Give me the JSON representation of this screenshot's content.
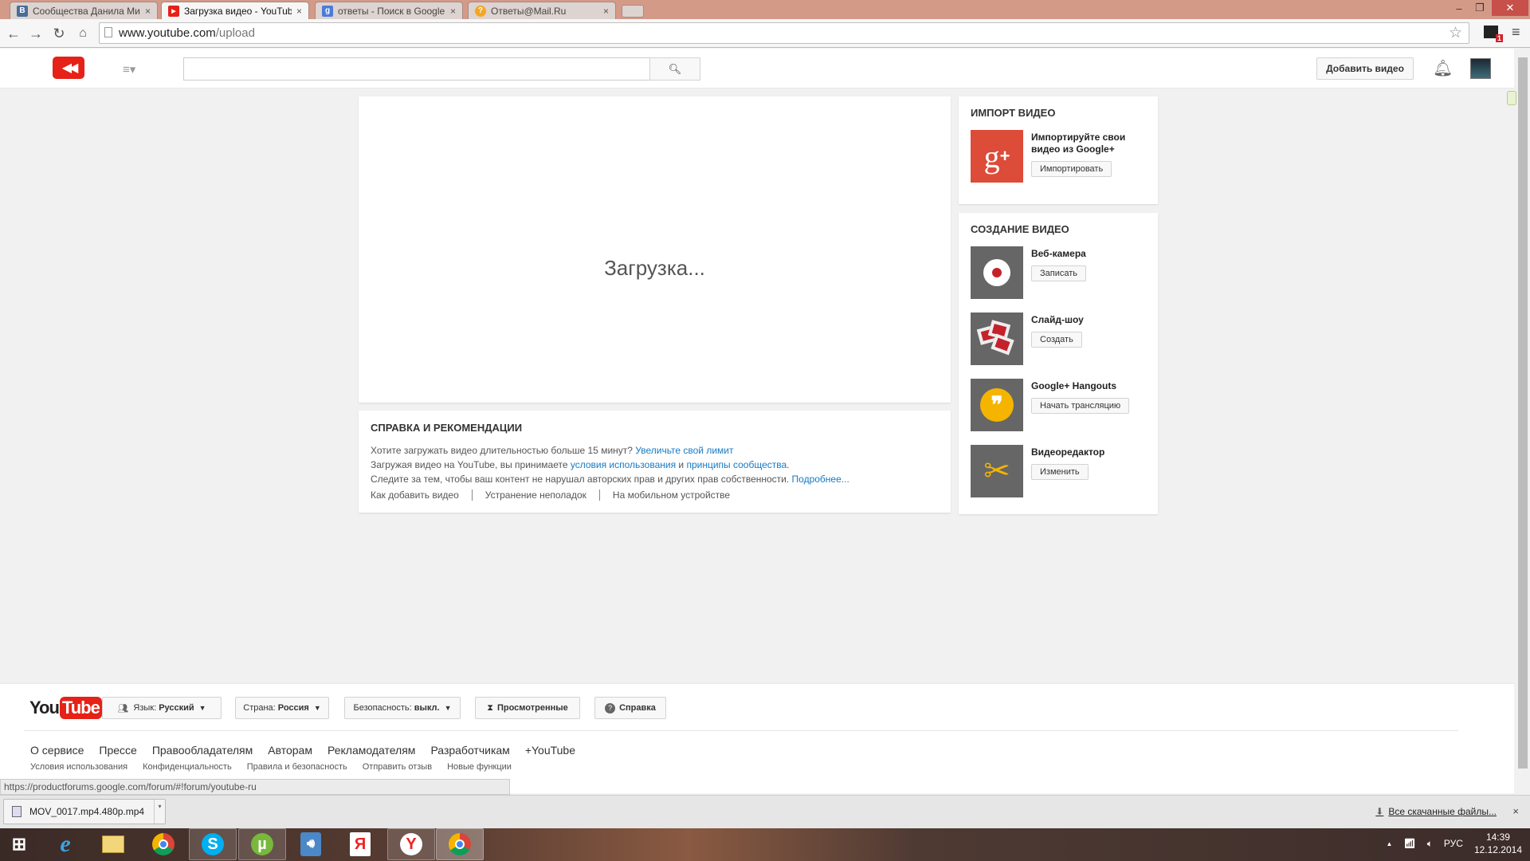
{
  "browser": {
    "tabs": [
      {
        "title": "Сообщества Данила Ми",
        "favicon": "vk-icon",
        "favicon_color": "#4a6d98",
        "favicon_letter": "B"
      },
      {
        "title": "Загрузка видео - YouTub",
        "favicon": "youtube-icon",
        "favicon_color": "#e62117",
        "favicon_letter": "▶",
        "active": true
      },
      {
        "title": "ответы - Поиск в Google",
        "favicon": "google-icon",
        "favicon_color": "#4c7bd9",
        "favicon_letter": "g"
      },
      {
        "title": "Ответы@Mail.Ru",
        "favicon": "mailru-answers-icon",
        "favicon_color": "#f5a623",
        "favicon_letter": "?"
      }
    ],
    "tab_close": "×",
    "url_host": "www.youtube.com",
    "url_path": "/upload",
    "window_controls": {
      "minimize": "–",
      "maximize": "❐",
      "close": "✕"
    },
    "extension_badge": "1"
  },
  "header": {
    "search_placeholder": "",
    "add_video_label": "Добавить видео"
  },
  "upload": {
    "loading_text": "Загрузка..."
  },
  "help": {
    "title": "СПРАВКА И РЕКОМЕНДАЦИИ",
    "line1_text": "Хотите загружать видео длительностью больше 15 минут? ",
    "line1_link": "Увеличьте свой лимит",
    "line2_text": "Загружая видео на YouTube, вы принимаете ",
    "line2_link1": "условия использования",
    "line2_mid": " и ",
    "line2_link2": "принципы сообщества",
    "line2_end": ".",
    "line3_text": "Следите за тем, чтобы ваш контент не нарушал авторских прав и других прав собственности. ",
    "line3_link": "Подробнее...",
    "links": [
      "Как добавить видео",
      "Устранение неполадок",
      "На мобильном устройстве"
    ]
  },
  "import": {
    "title": "ИМПОРТ ВИДЕО",
    "item_text": "Импортируйте свои видео из Google+",
    "button": "Импортировать"
  },
  "create": {
    "title": "СОЗДАНИЕ ВИДЕО",
    "items": [
      {
        "name": "Веб-камера",
        "button": "Записать",
        "icon": "webcam-record-icon"
      },
      {
        "name": "Слайд-шоу",
        "button": "Создать",
        "icon": "slideshow-icon"
      },
      {
        "name": "Google+ Hangouts",
        "button": "Начать трансляцию",
        "icon": "hangouts-icon"
      },
      {
        "name": "Видеоредактор",
        "button": "Изменить",
        "icon": "scissors-icon"
      }
    ]
  },
  "footer": {
    "logo_you": "You",
    "logo_tube": "Tube",
    "language_label": "Язык:",
    "language_value": "Русский",
    "country_label": "Страна:",
    "country_value": "Россия",
    "safety_label": "Безопасность:",
    "safety_value": "выкл.",
    "history": "Просмотренные",
    "help": "Справка",
    "links_primary": [
      "О сервисе",
      "Прессе",
      "Правообладателям",
      "Авторам",
      "Рекламодателям",
      "Разработчикам",
      "+YouTube"
    ],
    "links_secondary": [
      "Условия использования",
      "Конфиденциальность",
      "Правила и безопасность",
      "Отправить отзыв",
      "Новые функции"
    ]
  },
  "status_url": "https://productforums.google.com/forum/#!forum/youtube-ru",
  "downloads": {
    "file": "MOV_0017.mp4.480p.mp4",
    "all_files": "Все скачанные файлы...",
    "close": "×"
  },
  "taskbar": {
    "apps": [
      "windows-start",
      "internet-explorer",
      "file-explorer",
      "chrome",
      "skype",
      "utorrent",
      "audio-player",
      "yandex",
      "yandex-browser",
      "chrome-active"
    ],
    "language": "РУС",
    "time": "14:39",
    "date": "12.12.2014"
  }
}
